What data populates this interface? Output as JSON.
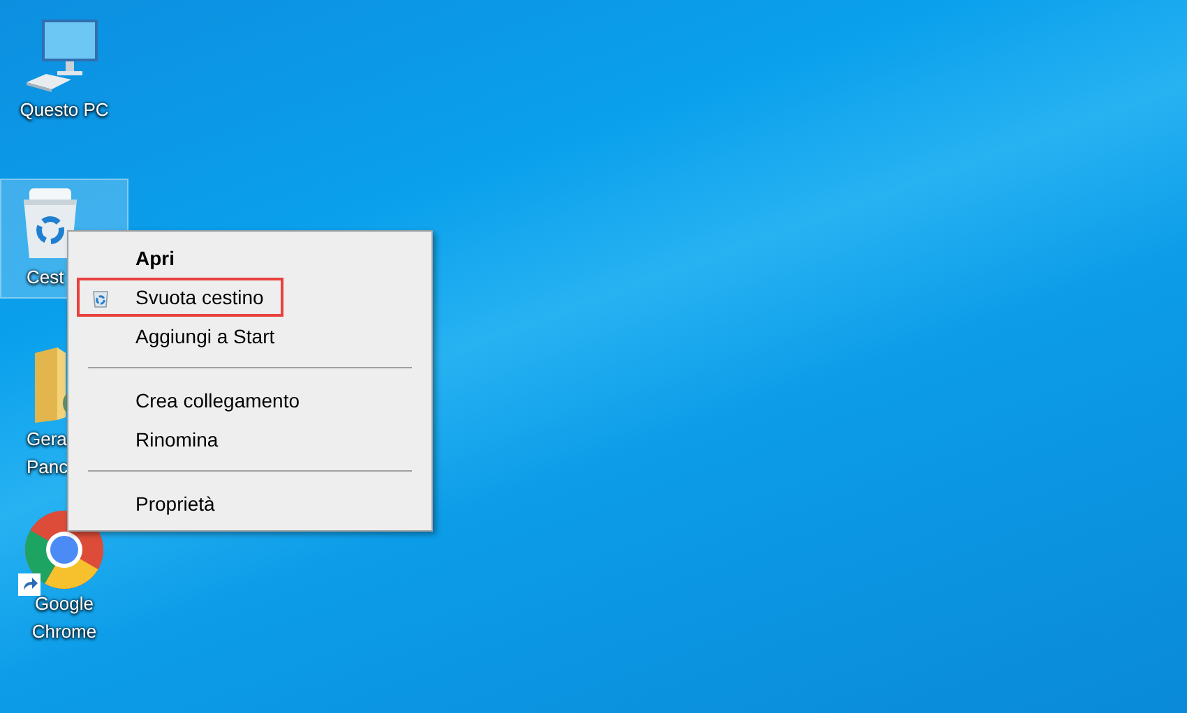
{
  "desktop_icons": [
    {
      "kind": "computer",
      "label_lines": [
        "Questo PC"
      ],
      "selected": false,
      "shortcut": false
    },
    {
      "kind": "recycle-bin",
      "label_lines": [
        "Cest"
      ],
      "selected": true,
      "shortcut": false
    },
    {
      "kind": "folder",
      "label_lines": [
        "Gera",
        "Panc"
      ],
      "selected": false,
      "shortcut": false
    },
    {
      "kind": "chrome",
      "label_lines": [
        "Google",
        "Chrome"
      ],
      "selected": false,
      "shortcut": true
    }
  ],
  "context_menu": {
    "items": [
      {
        "kind": "item",
        "label": "Apri",
        "default": true,
        "icon": false,
        "highlighted": false
      },
      {
        "kind": "item",
        "label": "Svuota cestino",
        "default": false,
        "icon": true,
        "highlighted": true
      },
      {
        "kind": "item",
        "label": "Aggiungi a Start",
        "default": false,
        "icon": false,
        "highlighted": false
      },
      {
        "kind": "separator"
      },
      {
        "kind": "item",
        "label": "Crea collegamento",
        "default": false,
        "icon": false,
        "highlighted": false
      },
      {
        "kind": "item",
        "label": "Rinomina",
        "default": false,
        "icon": false,
        "highlighted": false
      },
      {
        "kind": "separator"
      },
      {
        "kind": "item",
        "label": "Proprietà",
        "default": false,
        "icon": false,
        "highlighted": false
      }
    ]
  }
}
